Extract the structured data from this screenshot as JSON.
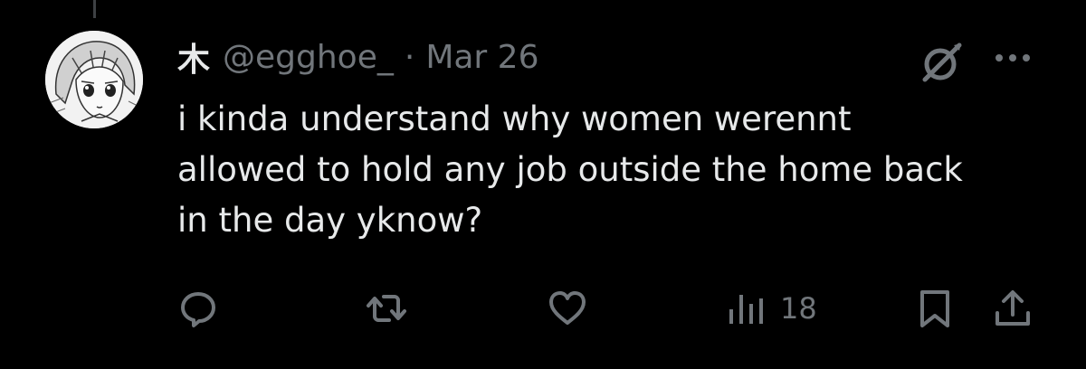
{
  "tweet": {
    "author": {
      "display_name": "木",
      "handle": "@egghoe_",
      "avatar": "manga-girl-avatar"
    },
    "separator": "·",
    "date": "Mar 26",
    "text": "i kinda understand why women werennt\nallowed to hold any job outside the home back\nin the day yknow?",
    "views_count": "18"
  },
  "icons": {
    "grok": "grok-icon",
    "more": "more-icon",
    "reply": "reply-icon",
    "retweet": "retweet-icon",
    "like": "heart-icon",
    "views": "views-icon",
    "bookmark": "bookmark-icon",
    "share": "share-icon"
  },
  "colors": {
    "background": "#000000",
    "text_primary": "#e7e9ea",
    "text_secondary": "#71767b",
    "icon": "#71767b"
  }
}
